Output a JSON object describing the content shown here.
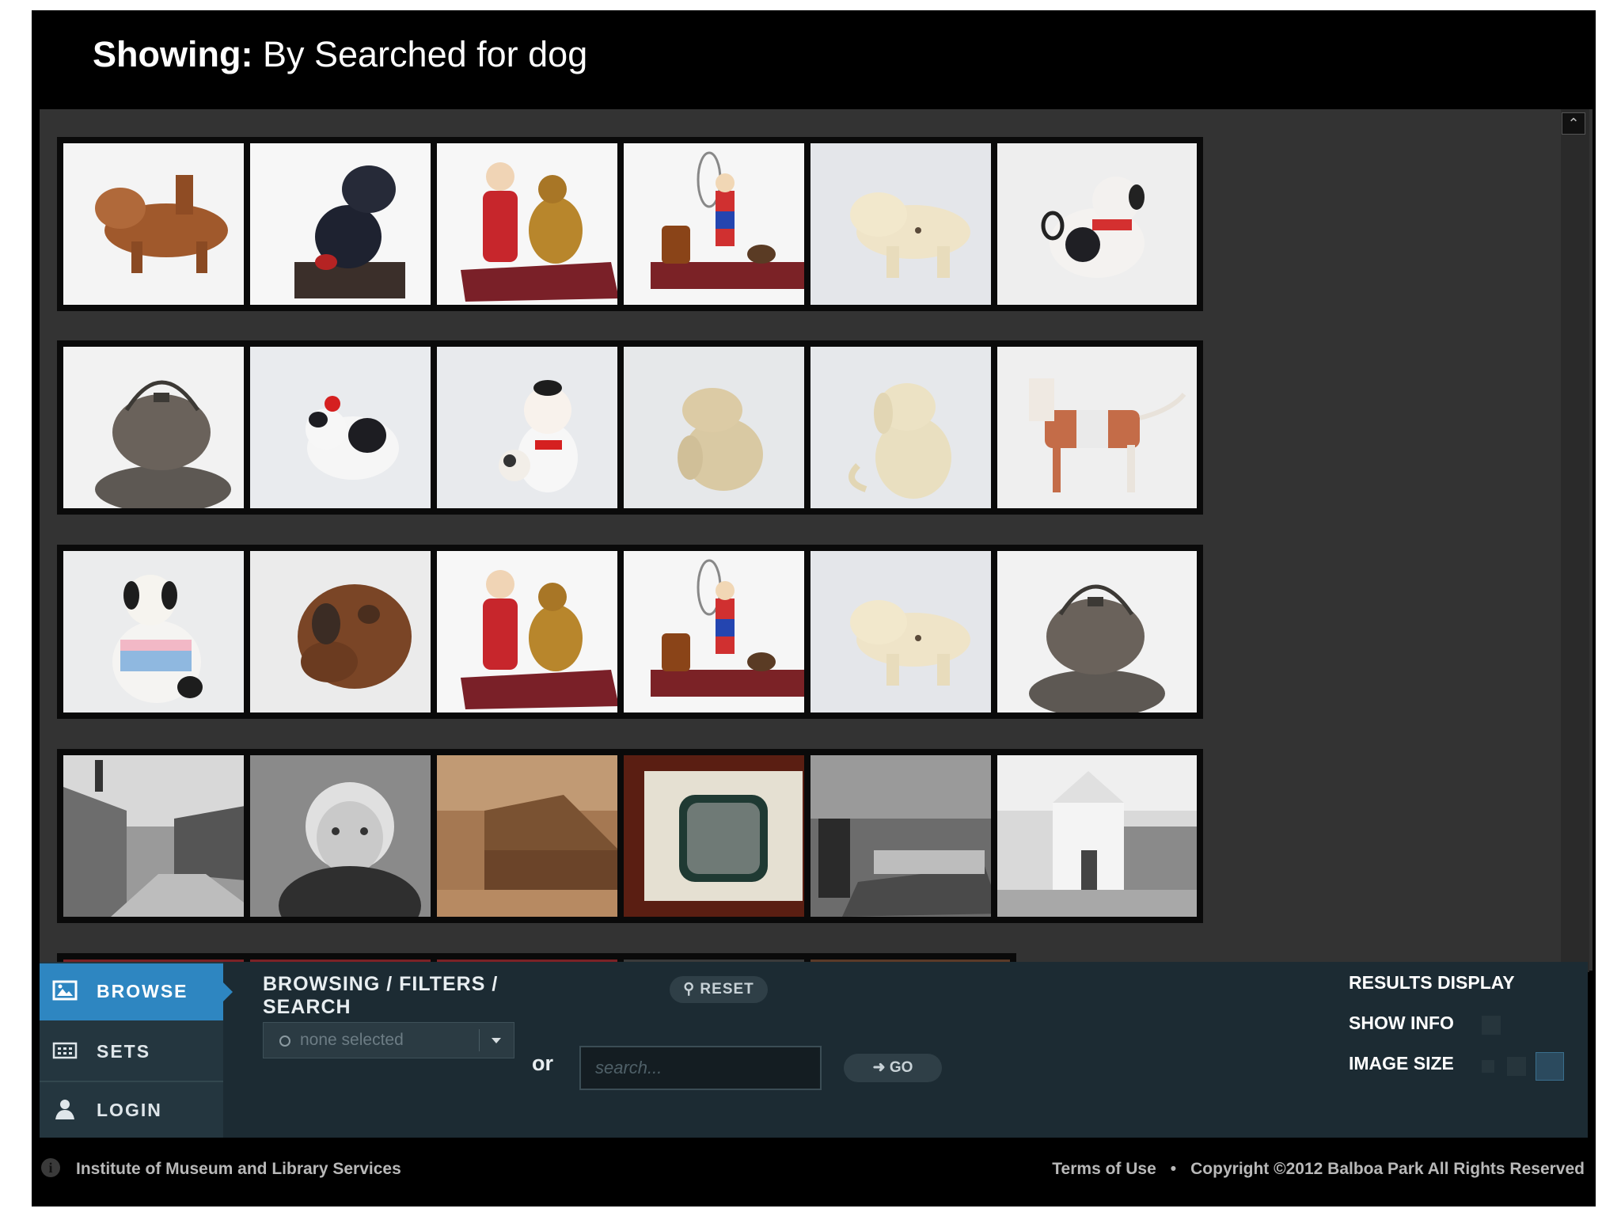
{
  "header": {
    "showing_label": "Showing:",
    "query_text": "By Searched for dog"
  },
  "gallery": {
    "scroll_up_icon": "chevron-up-icon"
  },
  "nav": {
    "browse_label": "BROWSE",
    "sets_label": "SETS",
    "login_label": "LOGIN"
  },
  "filters": {
    "label_line1": "BROWSING / FILTERS /",
    "label_line2": "SEARCH",
    "reset_label": "RESET",
    "select_value": "none selected",
    "or_label": "or",
    "search_placeholder": "search...",
    "go_label": "GO"
  },
  "results_display": {
    "title": "RESULTS DISPLAY",
    "show_info_label": "SHOW INFO",
    "image_size_label": "IMAGE SIZE"
  },
  "footer": {
    "left_text": "Institute of Museum and Library Services",
    "terms_label": "Terms of Use",
    "bullet": "•",
    "copyright": "Copyright ©2012 Balboa Park All Rights Reserved"
  },
  "colors": {
    "accent": "#2e86c1",
    "panel": "#1c2b33",
    "gallery_bg": "#333333"
  }
}
